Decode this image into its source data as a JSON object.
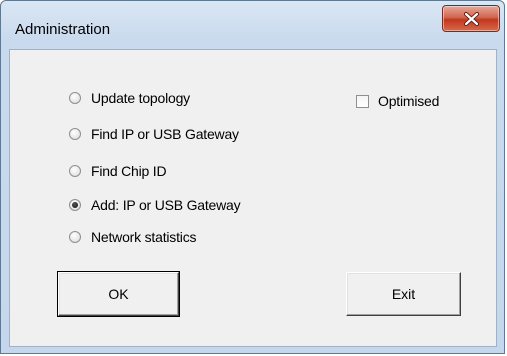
{
  "window": {
    "title": "Administration"
  },
  "options": [
    {
      "label": "Update topology",
      "checked": false
    },
    {
      "label": "Find IP or USB Gateway",
      "checked": false
    },
    {
      "label": "Find Chip ID",
      "checked": false
    },
    {
      "label": "Add: IP or USB Gateway",
      "checked": true
    },
    {
      "label": "Network statistics",
      "checked": false
    }
  ],
  "optimised": {
    "label": "Optimised",
    "checked": false
  },
  "buttons": {
    "ok_label": "OK",
    "exit_label": "Exit"
  },
  "colors": {
    "frame": "#c5d7ec",
    "client": "#f0f0f0",
    "close": "#c3371d"
  }
}
